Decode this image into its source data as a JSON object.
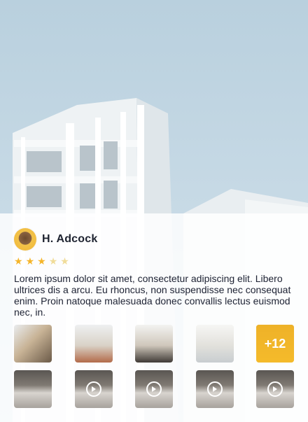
{
  "profile": {
    "name": "H. Adcock",
    "rating": 3,
    "max_rating": 5
  },
  "description": "Lorem ipsum dolor sit amet, consectetur adipiscing elit. Libero ultrices dis a arcu. Eu rhoncus, non suspendisse nec consequat enim. Proin natoque malesuada donec convallis lectus euismod nec, in.",
  "gallery": {
    "more_count_label": "+12"
  },
  "colors": {
    "accent": "#f5b52a",
    "text": "#1d2233",
    "sky": "#c6d9e5"
  },
  "icons": [
    "star-icon",
    "play-icon"
  ]
}
